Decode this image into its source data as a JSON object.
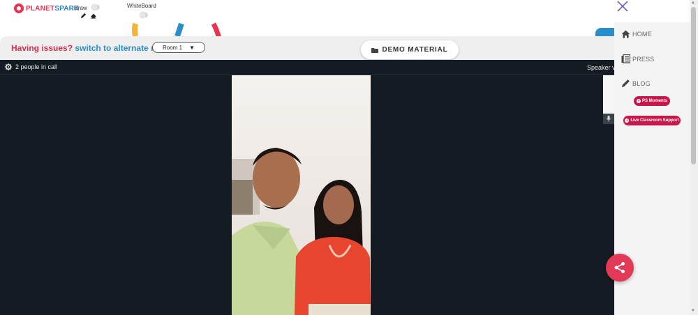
{
  "topbar": {
    "logo_text_a": "PLANET",
    "logo_text_b": "SPARK",
    "draw_label": "Draw",
    "whiteboard_label": "WhiteBoard"
  },
  "issue": {
    "prefix": "Having issues?",
    "link": "switch to alternate room",
    "room_selected": "Room 1"
  },
  "demo_material": "DEMO MATERIAL",
  "call": {
    "people_count": "2 people in call",
    "speaker_view": "Speaker vi"
  },
  "menu": {
    "items": [
      {
        "label": "HOME",
        "icon": "home-icon"
      },
      {
        "label": "PRESS",
        "icon": "newspaper-icon"
      },
      {
        "label": "BLOG",
        "icon": "pencil-icon"
      }
    ],
    "pill_moments": "PS Moments",
    "pill_support": "Live Classroom Support"
  },
  "colors": {
    "brand_red": "#e8344e",
    "link_blue": "#2a8fc9",
    "call_bg": "#141b22",
    "pill": "#c8174a"
  }
}
